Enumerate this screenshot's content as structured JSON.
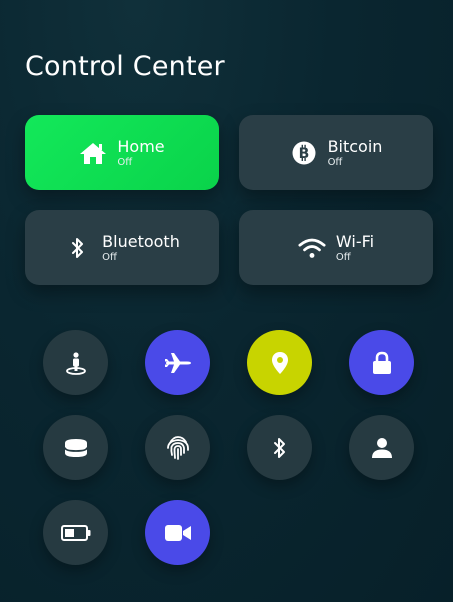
{
  "header": {
    "title": "Control Center"
  },
  "colors": {
    "active_tile": "#0fe052",
    "tile": "#2a3e46",
    "round_button": "#263a41",
    "accent_blue": "#4a4ae8",
    "accent_yellow": "#c8d400"
  },
  "tiles": [
    {
      "label": "Home",
      "state": "Off",
      "icon": "home-icon",
      "active": true
    },
    {
      "label": "Bitcoin",
      "state": "Off",
      "icon": "bitcoin-icon",
      "active": false
    },
    {
      "label": "Bluetooth",
      "state": "Off",
      "icon": "bluetooth-icon",
      "active": false
    },
    {
      "label": "Wi-Fi",
      "state": "Off",
      "icon": "wifi-icon",
      "active": false
    }
  ],
  "quick_buttons": [
    {
      "icon": "street-view-icon",
      "style": "dark"
    },
    {
      "icon": "airplane-icon",
      "style": "blue"
    },
    {
      "icon": "location-pin-icon",
      "style": "yellow"
    },
    {
      "icon": "lock-icon",
      "style": "blue"
    },
    {
      "icon": "database-icon",
      "style": "dark"
    },
    {
      "icon": "fingerprint-icon",
      "style": "dark"
    },
    {
      "icon": "bluetooth-icon",
      "style": "dark"
    },
    {
      "icon": "user-icon",
      "style": "dark"
    },
    {
      "icon": "battery-icon",
      "style": "dark"
    },
    {
      "icon": "video-camera-icon",
      "style": "blue"
    }
  ]
}
